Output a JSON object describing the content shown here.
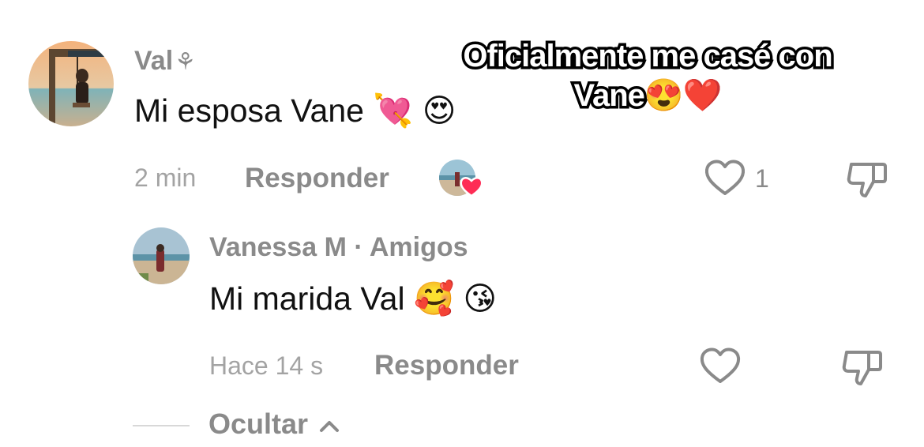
{
  "overlay": {
    "caption_line1": "Oficialmente me casé con",
    "caption_line2": "Vane😍❤️"
  },
  "comment": {
    "username": "Val",
    "username_symbol": "⚘",
    "text": "Mi esposa Vane 💘 😍",
    "time": "2 min",
    "reply_label": "Responder",
    "like_count": "1"
  },
  "reply": {
    "username": "Vanessa M · Amigos",
    "text": "Mi marida Val 🥰 😘",
    "time": "Hace 14 s",
    "reply_label": "Responder"
  },
  "thread": {
    "hide_label": "Ocultar"
  }
}
